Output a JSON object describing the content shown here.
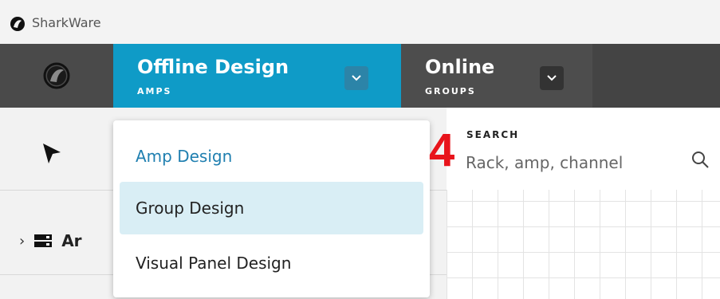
{
  "window": {
    "title": "SharkWare"
  },
  "nav": {
    "tabs": [
      {
        "label": "Offline Design",
        "sub": "AMPS"
      },
      {
        "label": "Online",
        "sub": "GROUPS"
      }
    ]
  },
  "dropdown": {
    "items": [
      {
        "label": "Amp Design"
      },
      {
        "label": "Group Design"
      },
      {
        "label": "Visual Panel Design"
      }
    ]
  },
  "sidebar": {
    "tree_item_label": "Ar"
  },
  "search": {
    "label": "SEARCH",
    "placeholder": "Rack, amp, channel"
  },
  "annotation": {
    "step": "4"
  },
  "colors": {
    "accent": "#0f9bc7",
    "nav_bg": "#444444",
    "annotation": "#e8141b",
    "selected_text": "#1f7fb0",
    "hover_bg": "#d9eef5"
  }
}
